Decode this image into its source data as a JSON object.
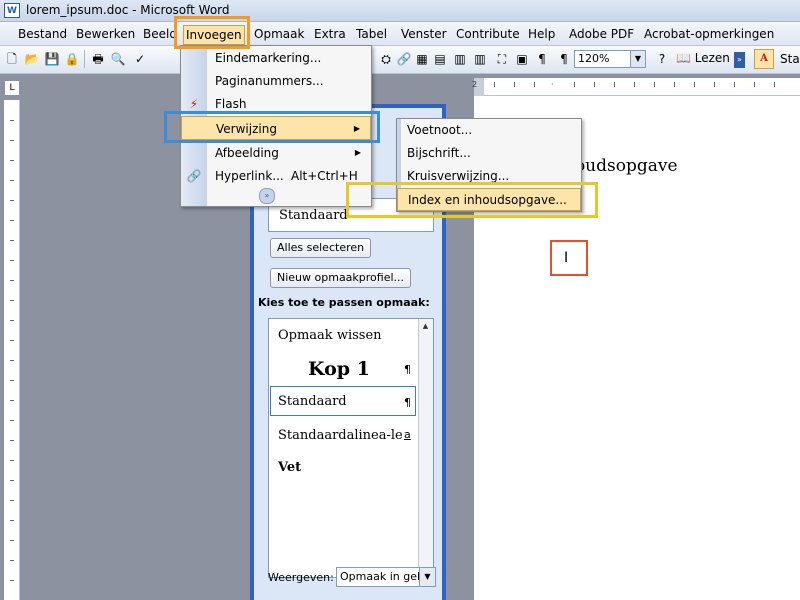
{
  "window": {
    "title": "lorem_ipsum.doc - Microsoft Word",
    "app_icon": "word-doc-icon"
  },
  "menubar": {
    "items": [
      {
        "label": "Bestand"
      },
      {
        "label": "Bewerken"
      },
      {
        "label": "Beeld"
      },
      {
        "label": "Invoegen"
      },
      {
        "label": "Opmaak"
      },
      {
        "label": "Extra"
      },
      {
        "label": "Tabel"
      },
      {
        "label": "Venster"
      },
      {
        "label": "Contribute"
      },
      {
        "label": "Help"
      },
      {
        "label": "Adobe PDF"
      },
      {
        "label": "Acrobat-opmerkingen"
      }
    ]
  },
  "toolbar": {
    "zoom": "120%",
    "read_button": "Lezen",
    "styles_button": "Stan"
  },
  "insert_menu": {
    "items": [
      {
        "label": "Eindemarkering...",
        "icon": ""
      },
      {
        "label": "Paginanummers...",
        "icon": ""
      },
      {
        "label": "Flash",
        "icon": "flash-icon"
      },
      {
        "label": "Verwijzing",
        "submenu": true
      },
      {
        "label": "Afbeelding",
        "submenu": true
      },
      {
        "label": "Hyperlink...",
        "shortcut": "Alt+Ctrl+H",
        "icon": "hyperlink-icon"
      }
    ],
    "expand_icon": "expand-chevron-icon"
  },
  "reference_submenu": {
    "items": [
      {
        "label": "Voetnoot..."
      },
      {
        "label": "Bijschrift..."
      },
      {
        "label": "Kruisverwijzing..."
      },
      {
        "label": "Index en inhoudsopgave..."
      }
    ]
  },
  "task_pane": {
    "current_style": "Standaard",
    "select_all_button": "Alles selecteren",
    "new_style_button": "Nieuw opmaakprofiel...",
    "choose_label": "Kies toe te passen opmaak:",
    "styles": [
      {
        "name": "Opmaak wissen",
        "mark": ""
      },
      {
        "name": "Kop 1",
        "mark": "¶"
      },
      {
        "name": "Standaard",
        "mark": "¶"
      },
      {
        "name": "Standaardalinea-lette",
        "mark": "a"
      },
      {
        "name": "Vet",
        "mark": ""
      }
    ],
    "show_label": "Weergeven:",
    "show_value": "Opmaak in gebr"
  },
  "document": {
    "heading_fragment": "houdsopgave",
    "cursor": "I"
  },
  "colors": {
    "highlight_orange": "#f39a22",
    "highlight_blue": "#3b8ed6",
    "highlight_yellow": "#e6c82a",
    "cursor_box": "#e0532a",
    "menu_hover": "#fde4a8",
    "pane_border": "#2e63c5"
  }
}
